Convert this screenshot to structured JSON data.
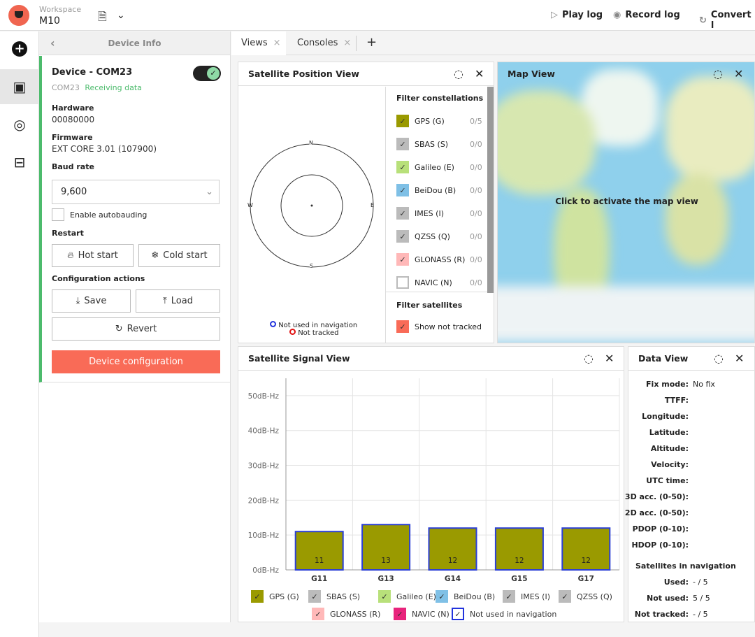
{
  "header": {
    "workspace_label": "Workspace",
    "workspace_name": "M10",
    "play_log": "Play log",
    "record_log": "Record log",
    "convert": "Convert l"
  },
  "sidebar": {
    "title": "Device Info",
    "device_name": "Device - COM23",
    "port": "COM23",
    "status": "Receiving data",
    "hardware_label": "Hardware",
    "hardware": "00080000",
    "firmware_label": "Firmware",
    "firmware": "EXT CORE 3.01 (107900)",
    "baud_label": "Baud rate",
    "baud": "9,600",
    "autobaud": "Enable autobauding",
    "restart_label": "Restart",
    "hot_start": "Hot start",
    "cold_start": "Cold start",
    "config_label": "Configuration actions",
    "save": "Save",
    "load": "Load",
    "revert": "Revert",
    "device_config": "Device configuration"
  },
  "tabs": [
    {
      "label": "Views"
    },
    {
      "label": "Consoles"
    }
  ],
  "sat_position": {
    "title": "Satellite Position View",
    "n": "N",
    "s": "S",
    "e": "E",
    "w": "W",
    "legend_not_used": "Not used in navigation",
    "legend_not_tracked": "Not tracked",
    "filter_title": "Filter constellations",
    "constellations": [
      {
        "label": "GPS (G)",
        "count": "0/5",
        "color": "#9a9a00"
      },
      {
        "label": "SBAS (S)",
        "count": "0/0",
        "color": "#bbbbbb"
      },
      {
        "label": "Galileo (E)",
        "count": "0/0",
        "color": "#b8e07a"
      },
      {
        "label": "BeiDou (B)",
        "count": "0/0",
        "color": "#7fc0e6"
      },
      {
        "label": "IMES (I)",
        "count": "0/0",
        "color": "#bbbbbb"
      },
      {
        "label": "QZSS (Q)",
        "count": "0/0",
        "color": "#bbbbbb"
      },
      {
        "label": "GLONASS (R)",
        "count": "0/0",
        "color": "#ffb8b8"
      },
      {
        "label": "NAVIC (N)",
        "count": "0/0",
        "color": "#ffffff"
      }
    ],
    "filter_sat_title": "Filter satellites",
    "show_not_tracked": "Show not tracked"
  },
  "map": {
    "title": "Map View",
    "message": "Click to activate the map view"
  },
  "signal": {
    "title": "Satellite Signal View",
    "legend": [
      {
        "label": "GPS (G)",
        "color": "#9a9a00"
      },
      {
        "label": "SBAS (S)",
        "color": "#bbbbbb"
      },
      {
        "label": "Galileo (E)",
        "color": "#b8e07a"
      },
      {
        "label": "BeiDou (B)",
        "color": "#7fc0e6"
      },
      {
        "label": "IMES (I)",
        "color": "#bbbbbb"
      },
      {
        "label": "QZSS (Q)",
        "color": "#bbbbbb"
      },
      {
        "label": "GLONASS (R)",
        "color": "#ffb8b8"
      },
      {
        "label": "NAVIC (N)",
        "color": "#e8247c"
      },
      {
        "label": "Not used in navigation",
        "color": "#ffffff"
      }
    ]
  },
  "chart_data": {
    "type": "bar",
    "categories": [
      "G11",
      "G13",
      "G14",
      "G15",
      "G17"
    ],
    "values": [
      11,
      13,
      12,
      12,
      12
    ],
    "ylim": [
      0,
      55
    ],
    "yticks": [
      "0dB-Hz",
      "10dB-Hz",
      "20dB-Hz",
      "30dB-Hz",
      "40dB-Hz",
      "50dB-Hz"
    ],
    "ytick_values": [
      0,
      10,
      20,
      30,
      40,
      50
    ],
    "bar_color": "#9a9a00",
    "bar_border": "#2b3fd6",
    "grid": true
  },
  "data_view": {
    "title": "Data View",
    "rows": [
      {
        "label": "Fix mode:",
        "value": "No fix"
      },
      {
        "label": "TTFF:",
        "value": ""
      },
      {
        "label": "Longitude:",
        "value": ""
      },
      {
        "label": "Latitude:",
        "value": ""
      },
      {
        "label": "Altitude:",
        "value": ""
      },
      {
        "label": "Velocity:",
        "value": ""
      },
      {
        "label": "UTC time:",
        "value": ""
      },
      {
        "label": "3D acc. (0-50):",
        "value": ""
      },
      {
        "label": "2D acc. (0-50):",
        "value": ""
      },
      {
        "label": "PDOP (0-10):",
        "value": ""
      },
      {
        "label": "HDOP (0-10):",
        "value": ""
      }
    ],
    "sat_title": "Satellites in navigation",
    "sat_rows": [
      {
        "label": "Used:",
        "value": "- / 5"
      },
      {
        "label": "Not used:",
        "value": "5 / 5"
      },
      {
        "label": "Not tracked:",
        "value": "- / 5"
      }
    ]
  }
}
